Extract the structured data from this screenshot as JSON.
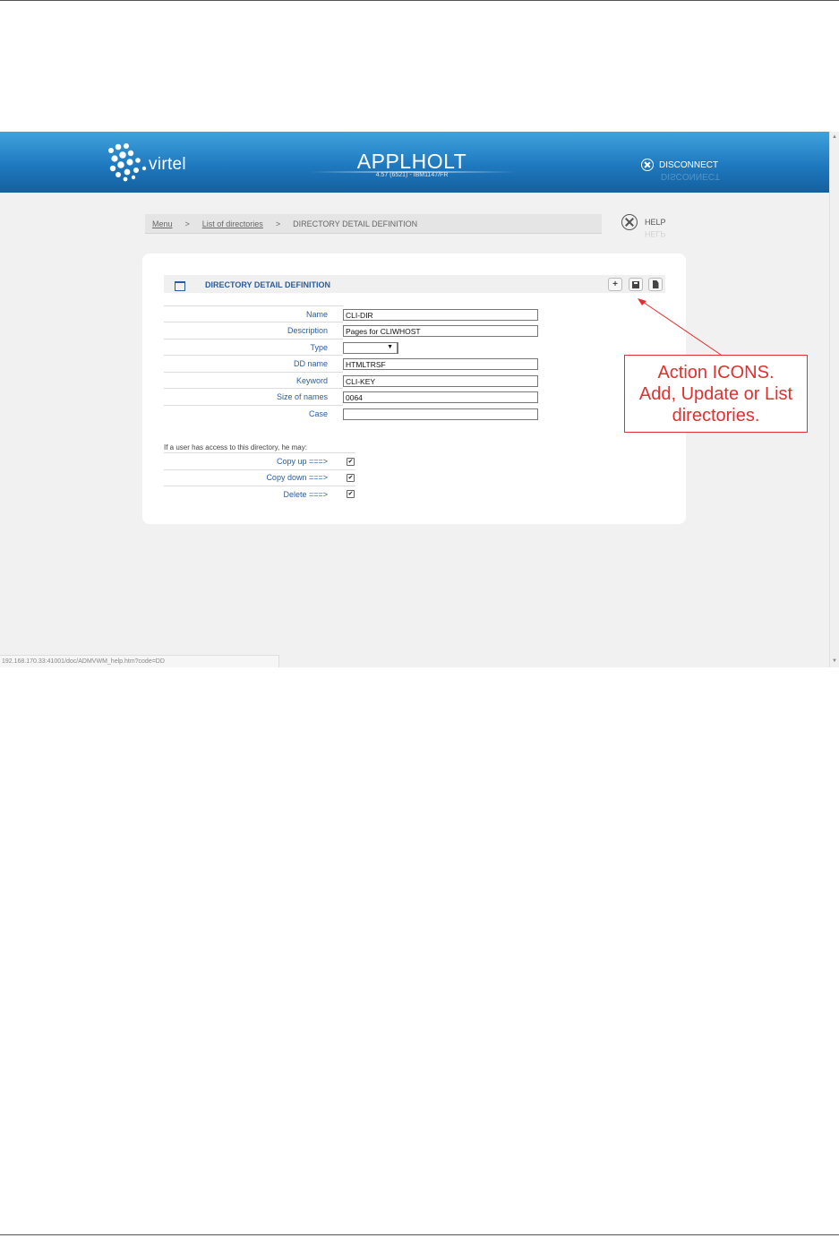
{
  "app": {
    "logo_text": "virtel",
    "title": "APPLHOLT",
    "subtitle": "4.57 (6521) - IBM1147/FR",
    "disconnect_label": "DISCONNECT"
  },
  "breadcrumb": {
    "items": [
      "Menu",
      "List of directories",
      "DIRECTORY DETAIL DEFINITION"
    ],
    "separator": ">"
  },
  "help_label": "HELP",
  "panel": {
    "title": "DIRECTORY DETAIL DEFINITION",
    "actions": [
      {
        "name": "add",
        "icon": "plus-icon",
        "glyph": "+"
      },
      {
        "name": "update",
        "icon": "floppy-disk-icon"
      },
      {
        "name": "list",
        "icon": "document-icon"
      }
    ]
  },
  "form": {
    "fields": [
      {
        "label": "Name",
        "value": "CLI-DIR"
      },
      {
        "label": "Description",
        "value": "Pages for CLIWHOST"
      },
      {
        "label": "Type",
        "value": ""
      },
      {
        "label": "DD name",
        "value": "HTMLTRSF"
      },
      {
        "label": "Keyword",
        "value": "CLI-KEY"
      },
      {
        "label": "Size of names",
        "value": "0064"
      },
      {
        "label": "Case",
        "value": ""
      }
    ],
    "access_intro": "If a user has access to this directory, he may:",
    "permissions": [
      {
        "label": "Copy up ===>",
        "checked": true
      },
      {
        "label": "Copy down ===>",
        "checked": true
      },
      {
        "label": "Delete ===>",
        "checked": true
      }
    ]
  },
  "status_url": "192.168.170.33:41001/doc/ADMVWM_help.htm?code=DD",
  "annotation": {
    "lines": [
      "Action ICONS.",
      "Add, Update or List",
      "directories."
    ],
    "color": "#e03030"
  },
  "colors": {
    "banner": "#1f79bf",
    "label_blue": "#2a5d9c"
  }
}
